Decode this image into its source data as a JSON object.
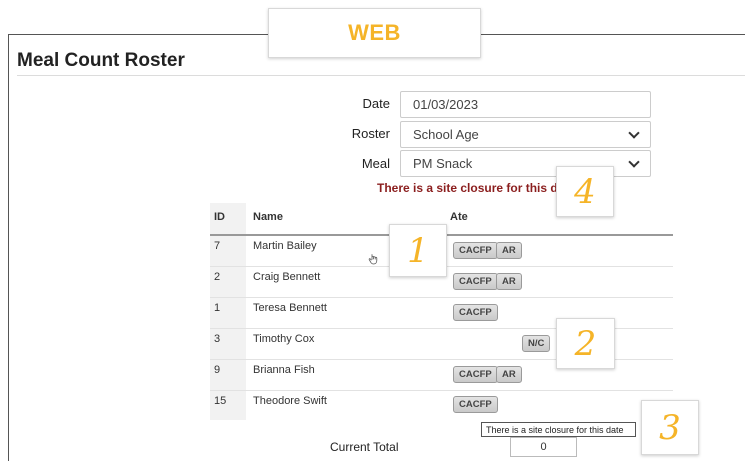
{
  "banner": {
    "label": "WEB"
  },
  "page": {
    "title": "Meal Count Roster"
  },
  "form": {
    "date": {
      "label": "Date",
      "value": "01/03/2023"
    },
    "roster": {
      "label": "Roster",
      "value": "School Age"
    },
    "meal": {
      "label": "Meal",
      "value": "PM Snack"
    }
  },
  "closure_message": "There is a site closure for this date",
  "table": {
    "headers": {
      "id": "ID",
      "name": "Name",
      "ate": "Ate"
    },
    "rows": [
      {
        "id": "7",
        "name": "Martin Bailey",
        "ate": [
          "CACFP",
          "AR"
        ]
      },
      {
        "id": "2",
        "name": "Craig Bennett",
        "ate": [
          "CACFP",
          "AR"
        ]
      },
      {
        "id": "1",
        "name": "Teresa Bennett",
        "ate": [
          "CACFP"
        ]
      },
      {
        "id": "3",
        "name": "Timothy Cox",
        "ate": [
          "N/C"
        ]
      },
      {
        "id": "9",
        "name": "Brianna Fish",
        "ate": [
          "CACFP",
          "AR"
        ]
      },
      {
        "id": "15",
        "name": "Theodore Swift",
        "ate": [
          "CACFP"
        ]
      }
    ]
  },
  "tooltip": "There is a site closure for this date",
  "total": {
    "label": "Current Total",
    "value": "0"
  },
  "callouts": [
    "1",
    "2",
    "3",
    "4"
  ],
  "icons": {
    "cursor": "hand-pointer-icon",
    "dropdown": "chevron-down-icon"
  },
  "colors": {
    "accent": "#f5b428",
    "closure_text": "#8b1e1e"
  }
}
